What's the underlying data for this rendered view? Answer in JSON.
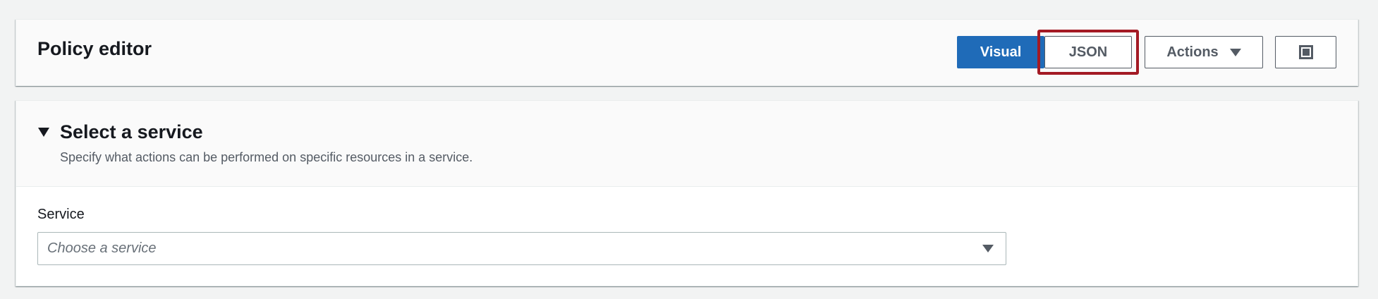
{
  "policy_editor": {
    "title": "Policy editor",
    "tabs": [
      {
        "label": "Visual",
        "selected": true
      },
      {
        "label": "JSON",
        "selected": false,
        "highlighted": true
      }
    ],
    "actions_label": "Actions",
    "fullscreen_icon": "fullscreen-icon"
  },
  "select_service": {
    "title": "Select a service",
    "description": "Specify what actions can be performed on specific resources in a service.",
    "expanded": true,
    "field_label": "Service",
    "placeholder": "Choose a service"
  },
  "colors": {
    "primary_button": "#1f6bb8",
    "highlight_border": "#a31a24",
    "page_background": "#f2f3f3"
  }
}
